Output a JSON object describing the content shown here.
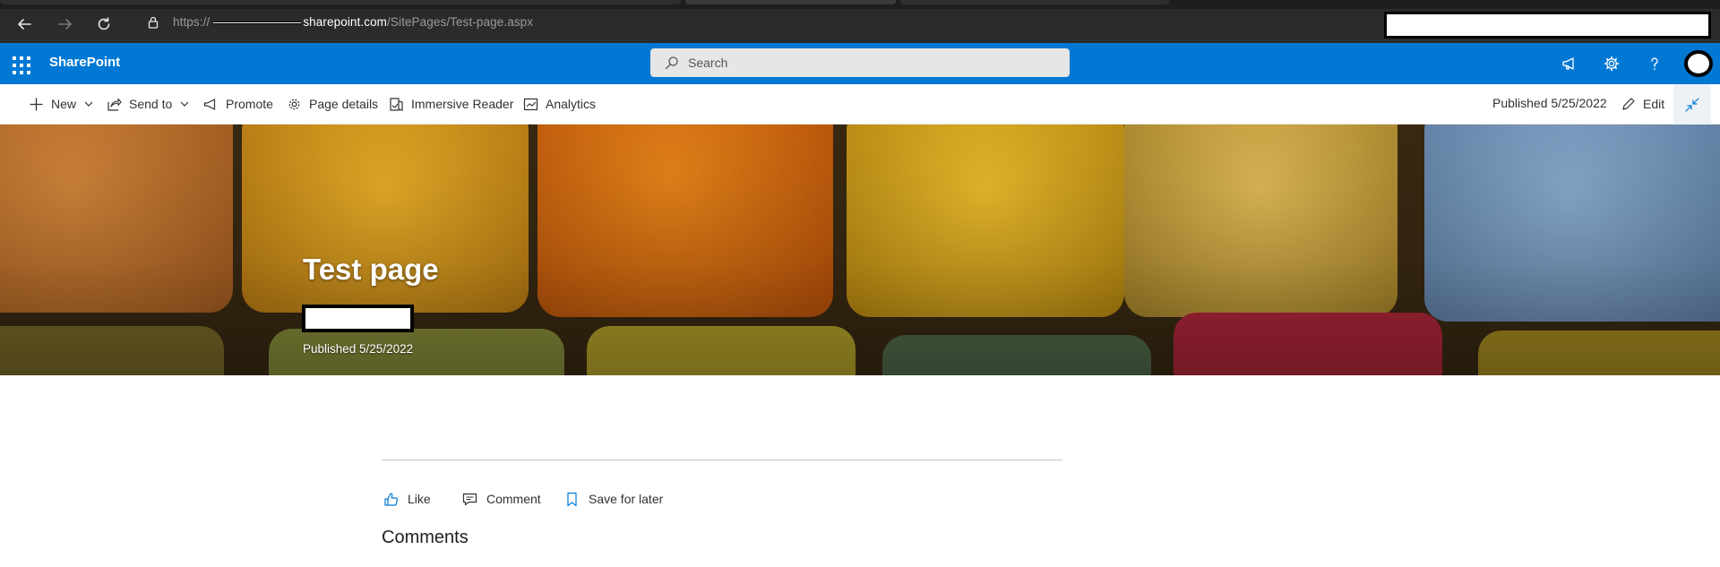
{
  "browser": {
    "url_prefix": "https://",
    "url_host": "sharepoint.com",
    "url_path": "/SitePages/Test-page.aspx",
    "icons": [
      "back-arrow-icon",
      "forward-arrow-icon",
      "refresh-icon",
      "lock-icon"
    ]
  },
  "suite_bar": {
    "brand": "SharePoint",
    "search_placeholder": "Search",
    "accent_color": "#0078d4",
    "icons": [
      "app-launcher-icon",
      "search-icon",
      "megaphone-icon",
      "gear-icon",
      "help-icon"
    ]
  },
  "command_bar": {
    "new_label": "New",
    "send_to_label": "Send to",
    "promote_label": "Promote",
    "page_details_label": "Page details",
    "immersive_reader_label": "Immersive Reader",
    "analytics_label": "Analytics",
    "published_label": "Published 5/25/2022",
    "edit_label": "Edit"
  },
  "hero": {
    "title": "Test page",
    "published": "Published 5/25/2022"
  },
  "social": {
    "like_label": "Like",
    "comment_label": "Comment",
    "save_label": "Save for later",
    "accent_color": "#0078d4"
  },
  "comments": {
    "heading": "Comments"
  }
}
